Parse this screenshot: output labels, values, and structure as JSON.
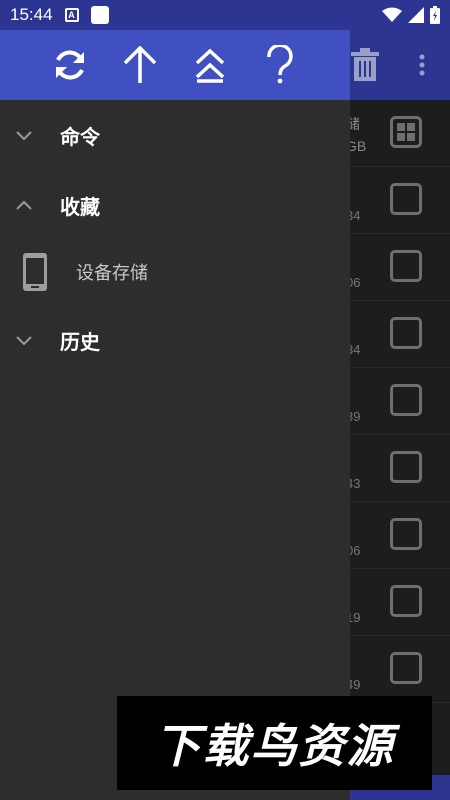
{
  "status_bar": {
    "time": "15:44",
    "notif_a_label": "A",
    "icons": [
      "a-notification-icon",
      "square-notification-icon",
      "wifi-icon",
      "signal-icon",
      "battery-icon"
    ]
  },
  "drawer": {
    "toolbar_icons": [
      "refresh-icon",
      "arrow-up-icon",
      "double-chevron-up-icon",
      "question-icon"
    ],
    "sections": {
      "commands": {
        "label": "命令",
        "expanded": false
      },
      "favorites": {
        "label": "收藏",
        "expanded": true
      },
      "history": {
        "label": "历史",
        "expanded": false
      }
    },
    "favorites_items": [
      {
        "label": "设备存储",
        "icon": "phone-icon"
      }
    ]
  },
  "background_list": {
    "toolbar_icons": [
      "trash-icon",
      "more-vert-icon"
    ],
    "header": {
      "line1": "储",
      "line2": "GB"
    },
    "row_fragments": [
      "34",
      "06",
      "34",
      "39",
      "43",
      "06",
      "19",
      "49"
    ]
  },
  "watermark": {
    "text": "下载鸟资源"
  },
  "colors": {
    "status_bar": "#2d3593",
    "drawer_header": "#4150c0",
    "drawer_bg": "#2d2d2d",
    "list_bg": "#1d1d1d"
  }
}
